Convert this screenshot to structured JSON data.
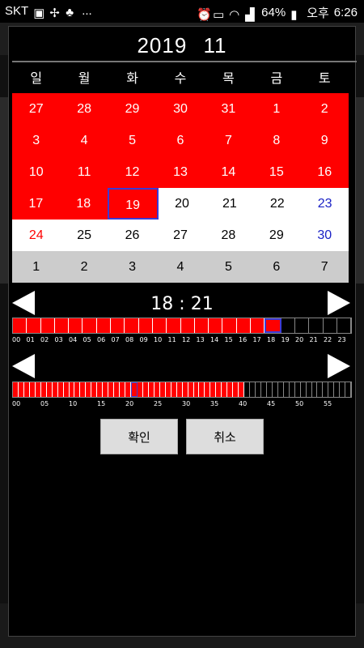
{
  "status_bar": {
    "carrier": "SKT",
    "dots": "...",
    "battery": "64%",
    "ampm": "오후",
    "time": "6:26"
  },
  "calendar": {
    "year": "2019",
    "month": "11",
    "weekdays": [
      "일",
      "월",
      "화",
      "수",
      "목",
      "금",
      "토"
    ],
    "weeks": [
      [
        "27",
        "28",
        "29",
        "30",
        "31",
        "1",
        "2"
      ],
      [
        "3",
        "4",
        "5",
        "6",
        "7",
        "8",
        "9"
      ],
      [
        "10",
        "11",
        "12",
        "13",
        "14",
        "15",
        "16"
      ],
      [
        "17",
        "18",
        "19",
        "20",
        "21",
        "22",
        "23"
      ],
      [
        "24",
        "25",
        "26",
        "27",
        "28",
        "29",
        "30"
      ],
      [
        "1",
        "2",
        "3",
        "4",
        "5",
        "6",
        "7"
      ]
    ],
    "selected_day": "19"
  },
  "time_picker": {
    "hour": "18",
    "minute": "21",
    "hour_labels": [
      "00",
      "01",
      "02",
      "03",
      "04",
      "05",
      "06",
      "07",
      "08",
      "09",
      "10",
      "11",
      "12",
      "13",
      "14",
      "15",
      "16",
      "17",
      "18",
      "19",
      "20",
      "21",
      "22",
      "23"
    ],
    "minute_labels": [
      "00",
      "05",
      "10",
      "15",
      "20",
      "25",
      "30",
      "35",
      "40",
      "45",
      "50",
      "55"
    ]
  },
  "buttons": {
    "confirm": "확인",
    "cancel": "취소"
  },
  "colors": {
    "past": "#ff0000",
    "selected_border": "#3b3bd6",
    "saturday": "#1b22c6",
    "sunday": "#ff0000"
  }
}
